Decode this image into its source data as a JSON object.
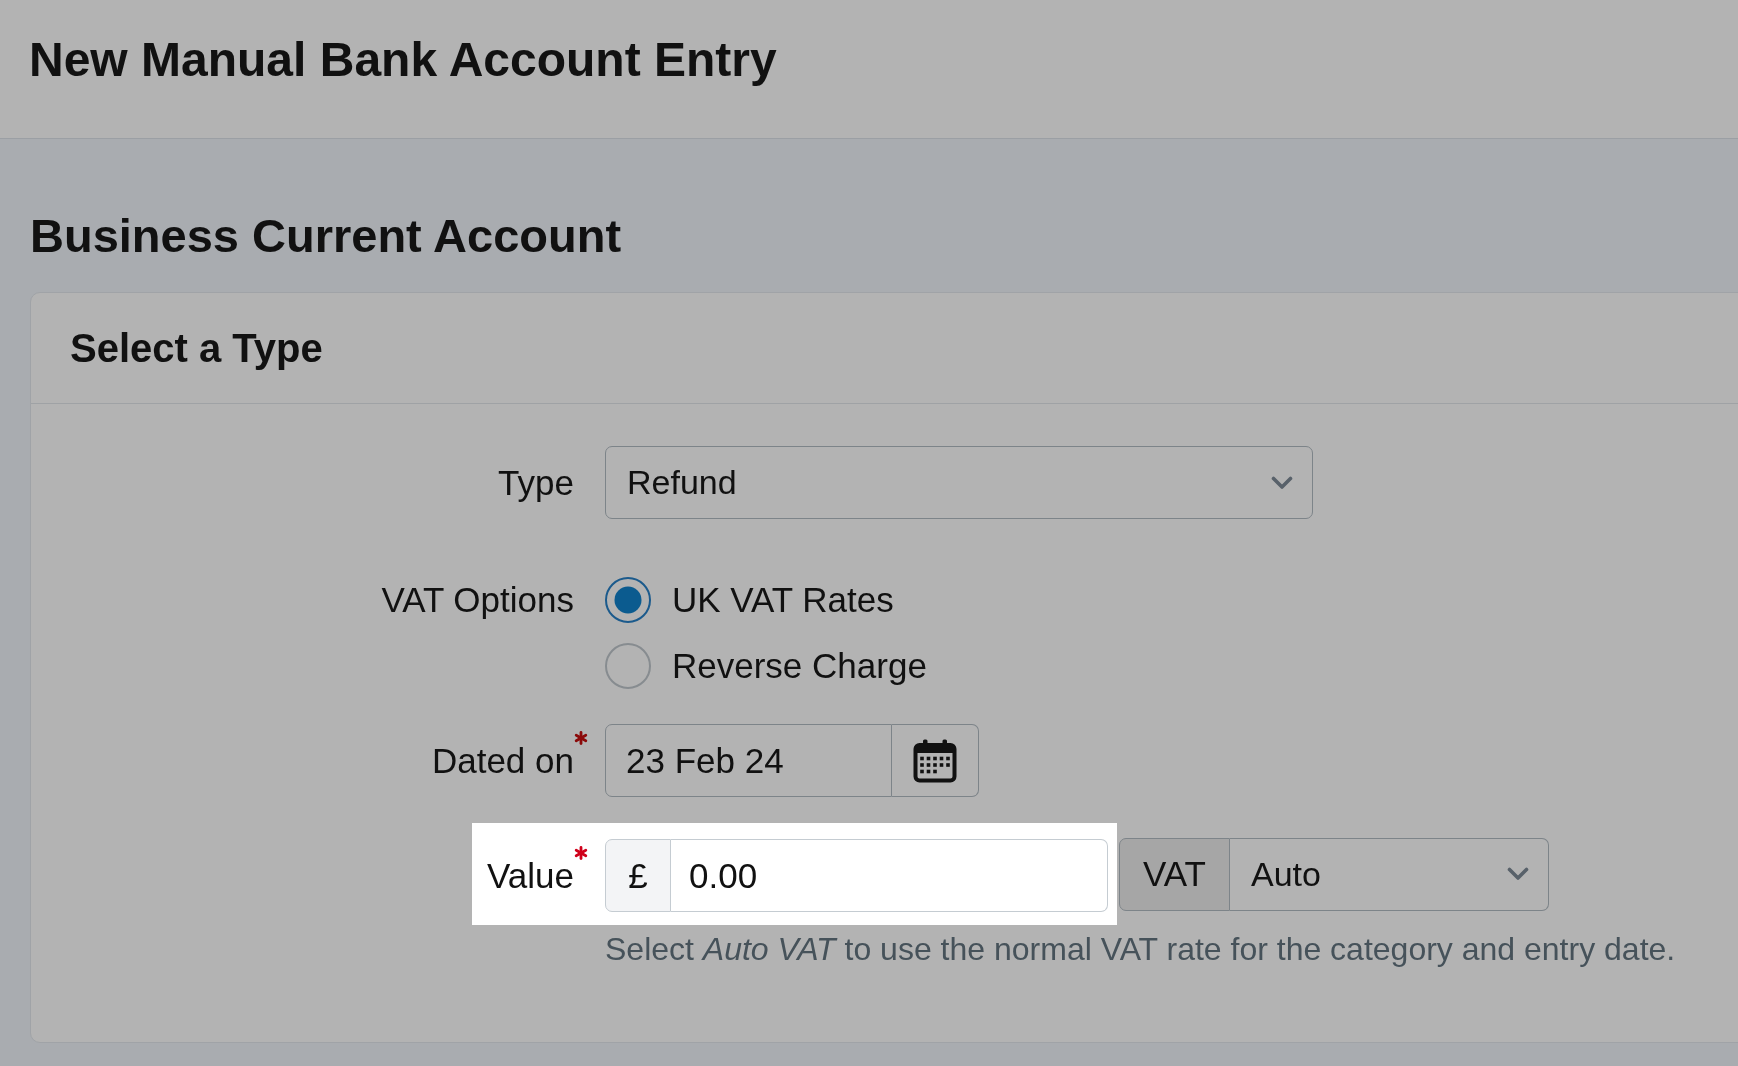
{
  "page_title": "New Manual Bank Account Entry",
  "account": {
    "name": "Business Current Account"
  },
  "card": {
    "title": "Select a Type",
    "fields": [
      {
        "kind": "select",
        "label": "Type",
        "required": false,
        "value": "Refund"
      },
      {
        "kind": "radio",
        "label": "VAT Options",
        "required": false,
        "options": [
          {
            "label": "UK VAT Rates",
            "selected": true
          },
          {
            "label": "Reverse Charge",
            "selected": false
          }
        ]
      },
      {
        "kind": "date",
        "label": "Dated on",
        "required": true,
        "value": "23 Feb 24"
      },
      {
        "kind": "money",
        "label": "Value",
        "required": true,
        "highlighted": true,
        "currency": "£",
        "value": "0.00",
        "vat": {
          "label": "VAT",
          "value": "Auto"
        },
        "help": "Select *Auto VAT* to use the normal VAT rate for the category and entry date."
      }
    ]
  }
}
